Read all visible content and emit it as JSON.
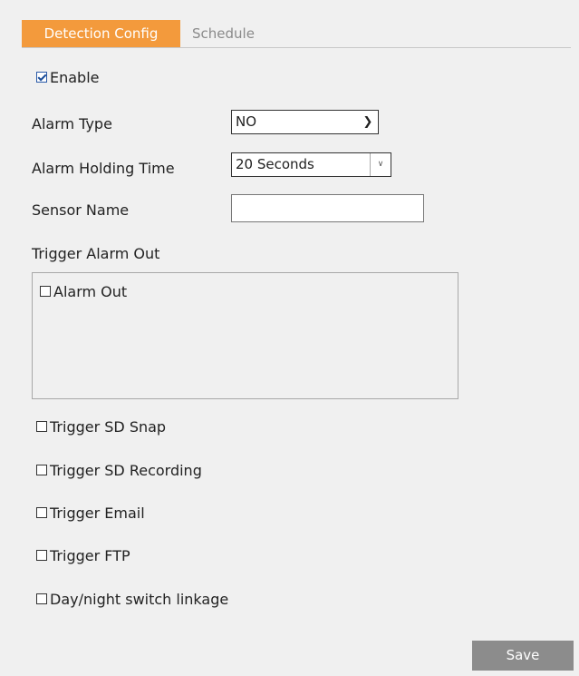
{
  "tabs": [
    {
      "label": "Detection Config",
      "active": true
    },
    {
      "label": "Schedule",
      "active": false
    }
  ],
  "enable": {
    "label": "Enable",
    "checked": true
  },
  "alarm_type": {
    "label": "Alarm Type",
    "value": "NO"
  },
  "alarm_holding_time": {
    "label": "Alarm Holding Time",
    "value": "20 Seconds"
  },
  "sensor_name": {
    "label": "Sensor Name",
    "value": ""
  },
  "trigger_alarm_out": {
    "label": "Trigger Alarm Out",
    "items": [
      {
        "label": "Alarm Out",
        "checked": false
      }
    ]
  },
  "triggers": [
    {
      "label": "Trigger SD Snap",
      "checked": false
    },
    {
      "label": "Trigger SD Recording",
      "checked": false
    },
    {
      "label": "Trigger Email",
      "checked": false
    },
    {
      "label": "Trigger FTP",
      "checked": false
    },
    {
      "label": "Day/night switch linkage",
      "checked": false
    }
  ],
  "save_label": "Save",
  "colors": {
    "tab_active": "#f39a3c",
    "save_button": "#8c8c8c",
    "background": "#f0f0f0"
  }
}
